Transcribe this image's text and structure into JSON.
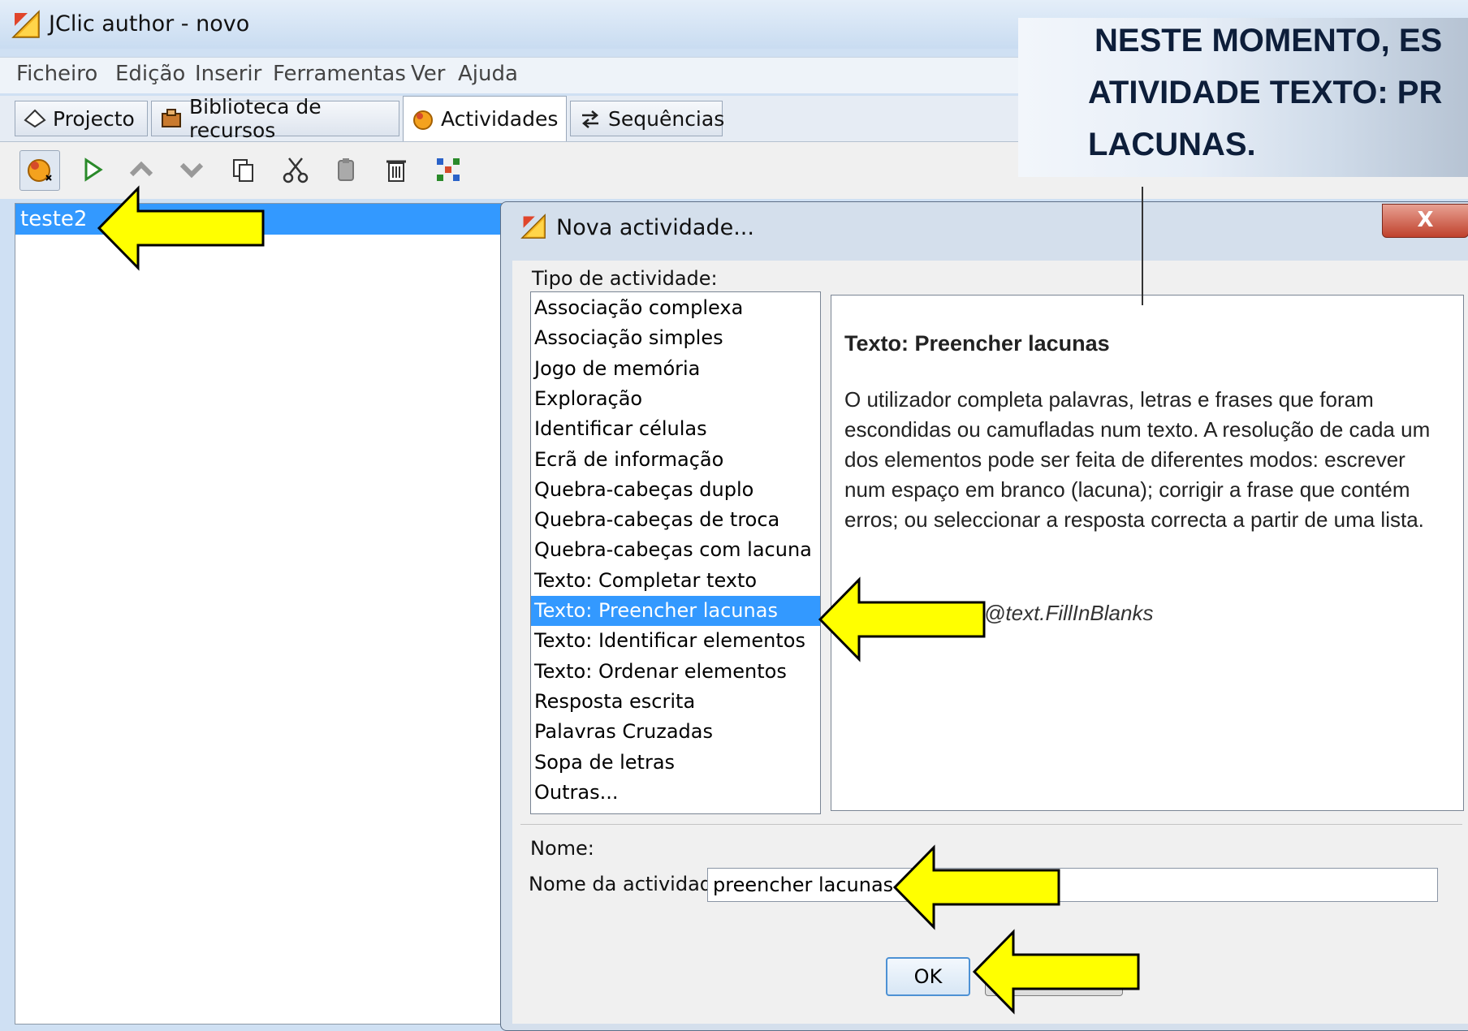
{
  "window": {
    "title": "JClic author - novo"
  },
  "menu": [
    "Ficheiro",
    "Edição",
    "Inserir",
    "Ferramentas",
    "Ver",
    "Ajuda"
  ],
  "tabs": [
    {
      "label": "Projecto",
      "icon": "project-icon"
    },
    {
      "label": "Biblioteca de recursos",
      "icon": "library-icon"
    },
    {
      "label": "Actividades",
      "icon": "activities-icon",
      "active": true
    },
    {
      "label": "Sequências",
      "icon": "sequences-icon"
    }
  ],
  "toolbar_icons": [
    "new-activity-icon",
    "play-icon",
    "move-up-icon",
    "move-down-icon",
    "copy-icon",
    "cut-icon",
    "paste-icon",
    "delete-icon",
    "grid-icon"
  ],
  "activities_list": [
    "teste2"
  ],
  "callout": {
    "lines": [
      "NESTE MOMENTO, ES",
      "ATIVIDADE TEXTO: PR",
      "LACUNAS."
    ]
  },
  "dialog": {
    "title": "Nova actividade...",
    "close_label": "X",
    "type_label": "Tipo de actividade:",
    "types": [
      "Associação complexa",
      "Associação simples",
      "Jogo de memória",
      "Exploração",
      "Identificar células",
      "Ecrã de informação",
      "Quebra-cabeças duplo",
      "Quebra-cabeças de troca",
      "Quebra-cabeças com lacuna",
      "Texto: Completar texto",
      "Texto: Preencher lacunas",
      "Texto: Identificar elementos",
      "Texto: Ordenar elementos",
      "Resposta escrita",
      "Palavras Cruzadas",
      "Sopa de letras",
      "Outras..."
    ],
    "selected_type": "Texto: Preencher lacunas",
    "description": {
      "title": "Texto: Preencher lacunas",
      "body": "O utilizador completa palavras, letras e frases que foram escondidas ou camufladas num texto. A resolução de cada um dos elementos pode ser feita de diferentes modos: escrever num espaço em branco (lacuna); corrigir a frase que contém erros; ou seleccionar a resposta correcta a partir de uma lista.",
      "class": "@text.FillInBlanks"
    },
    "name_group_label": "Nome:",
    "name_field_label": "Nome da actividade",
    "name_value": "preencher lacunas",
    "ok_label": "OK"
  },
  "colors": {
    "selection": "#3399ff",
    "arrow_fill": "#ffff00",
    "arrow_stroke": "#000000"
  }
}
